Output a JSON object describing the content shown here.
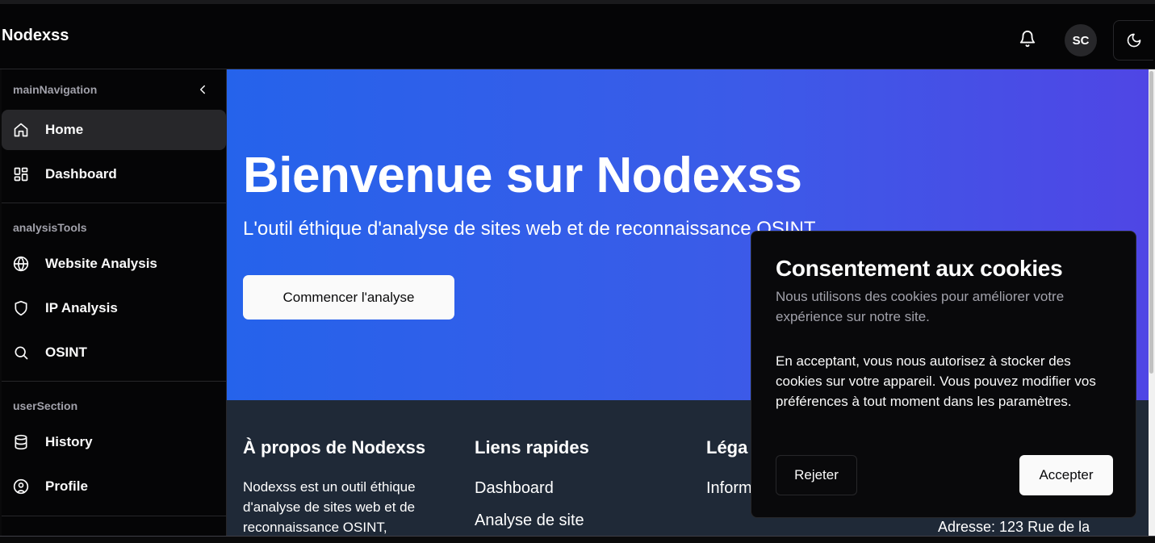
{
  "header": {
    "brand": "Nodexss",
    "avatar_initials": "SC"
  },
  "sidebar": {
    "sections": [
      {
        "label": "mainNavigation"
      },
      {
        "label": "analysisTools"
      },
      {
        "label": "userSection"
      }
    ],
    "items": [
      {
        "label": "Home",
        "icon": "home-icon",
        "active": true
      },
      {
        "label": "Dashboard",
        "icon": "dashboard-icon"
      },
      {
        "label": "Website Analysis",
        "icon": "globe-icon"
      },
      {
        "label": "IP Analysis",
        "icon": "shield-icon"
      },
      {
        "label": "OSINT",
        "icon": "search-icon"
      },
      {
        "label": "History",
        "icon": "database-icon"
      },
      {
        "label": "Profile",
        "icon": "user-circle-icon"
      }
    ]
  },
  "hero": {
    "title": "Bienvenue sur Nodexss",
    "subtitle": "L'outil éthique d'analyse de sites web et de reconnaissance OSINT",
    "cta": "Commencer l'analyse"
  },
  "footer": {
    "about": {
      "title": "À propos de Nodexss",
      "text": "Nodexss est un outil éthique d'analyse de sites web et de reconnaissance OSINT,"
    },
    "links": {
      "title": "Liens rapides",
      "items": [
        "Dashboard",
        "Analyse de site"
      ]
    },
    "legal": {
      "title": "Léga",
      "items": [
        "Inform"
      ]
    },
    "contact": {
      "address": "Adresse: 123 Rue de la"
    }
  },
  "cookie": {
    "title": "Consentement aux cookies",
    "description": "Nous utilisons des cookies pour améliorer votre expérience sur notre site.",
    "body": "En acceptant, vous nous autorisez à stocker des cookies sur votre appareil. Vous pouvez modifier vos préférences à tout moment dans les paramètres.",
    "reject": "Rejeter",
    "accept": "Accepter"
  },
  "colors": {
    "hero_start": "#2563eb",
    "hero_end": "#4f46e5",
    "footer_bg": "#1f2937",
    "sidebar_active": "#27272a"
  }
}
